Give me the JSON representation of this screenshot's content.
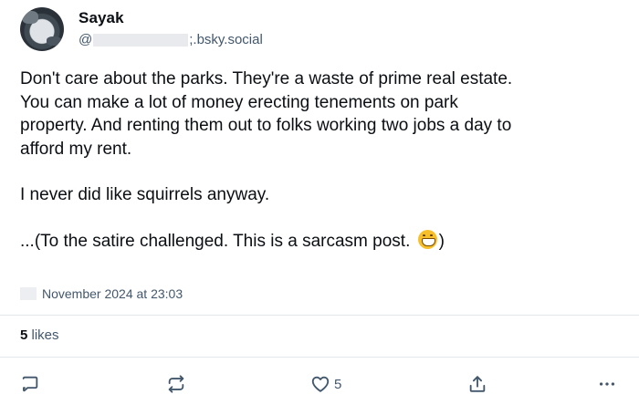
{
  "post": {
    "display_name": "Sayak",
    "handle_prefix": "@",
    "handle_suffix": ";.bsky.social",
    "paragraph1": [
      "Don't care about the parks. They're a waste of prime real estate.",
      "You can make a lot of money erecting tenements on park",
      "property. And renting them out to folks working two jobs a day to",
      "afford my rent."
    ],
    "paragraph2": "I never did like squirrels anyway.",
    "paragraph3_before": "...(To the satire challenged. This is a sarcasm post. ",
    "paragraph3_after": ")",
    "emoji": "grinning-face-emoji",
    "timestamp": "November 2024 at 23:03",
    "likes_count": "5",
    "likes_label": "likes"
  },
  "actions": {
    "like_count": "5",
    "icons": [
      "reply-icon",
      "repost-icon",
      "heart-icon",
      "share-icon",
      "more-icon"
    ]
  },
  "colors": {
    "text": "#0b0f14",
    "muted": "#42576c",
    "divider": "#e3e8ed"
  }
}
